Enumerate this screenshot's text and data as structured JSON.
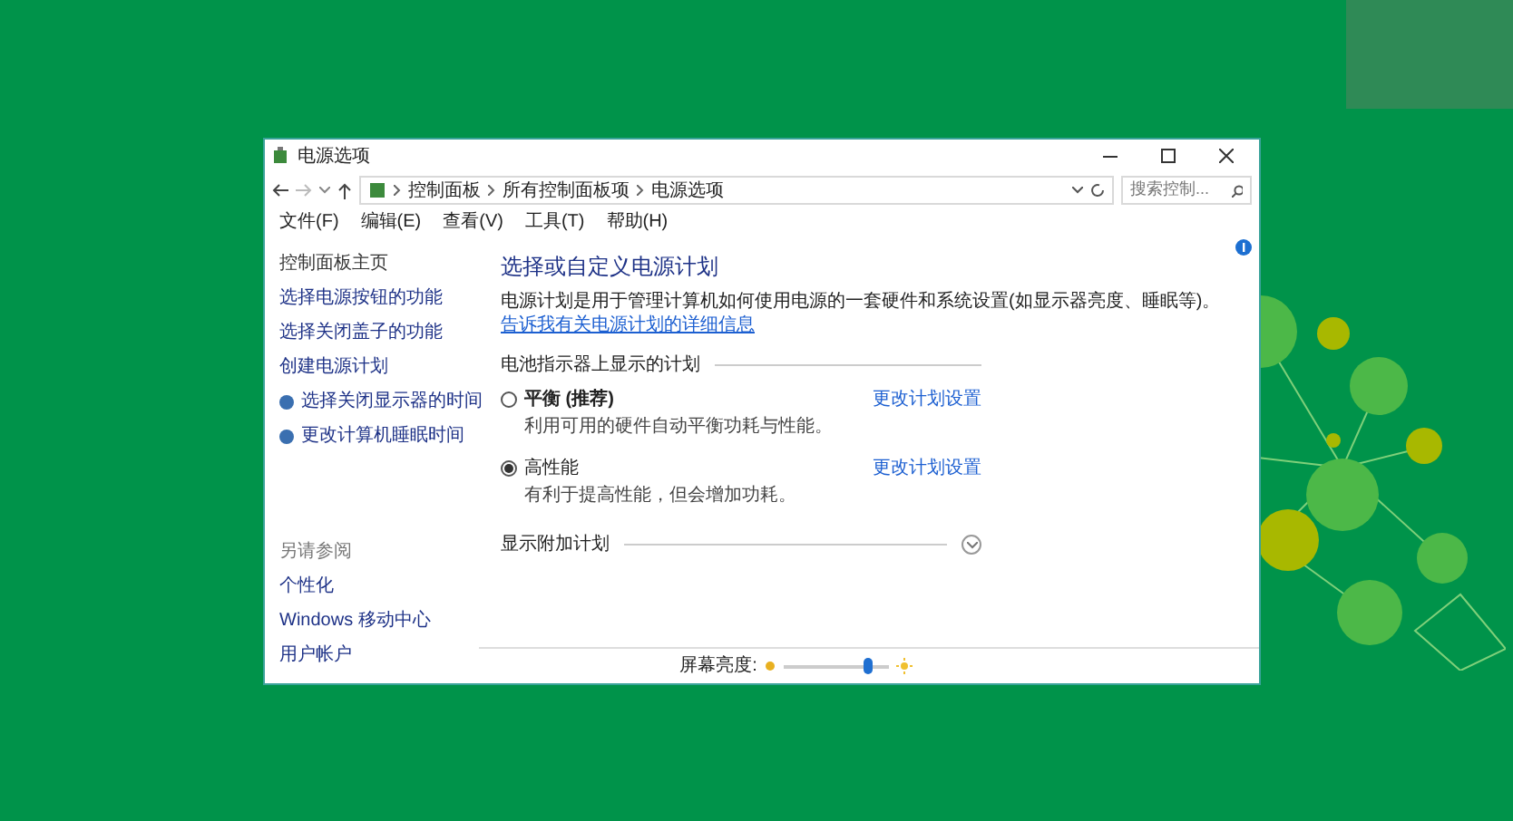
{
  "window": {
    "title": "电源选项"
  },
  "address_bar": {
    "breadcrumbs": [
      "控制面板",
      "所有控制面板项",
      "电源选项"
    ]
  },
  "search": {
    "placeholder": "搜索控制..."
  },
  "menu": [
    "文件(F)",
    "编辑(E)",
    "查看(V)",
    "工具(T)",
    "帮助(H)"
  ],
  "sidebar": {
    "items": [
      {
        "label": "控制面板主页",
        "kind": "plain"
      },
      {
        "label": "选择电源按钮的功能",
        "kind": "link"
      },
      {
        "label": "选择关闭盖子的功能",
        "kind": "link"
      },
      {
        "label": "创建电源计划",
        "kind": "link"
      },
      {
        "label": "选择关闭显示器的时间",
        "kind": "icon"
      },
      {
        "label": "更改计算机睡眠时间",
        "kind": "icon"
      }
    ],
    "see_also": {
      "heading": "另请参阅",
      "items": [
        "个性化",
        "Windows 移动中心",
        "用户帐户"
      ]
    }
  },
  "main": {
    "heading": "选择或自定义电源计划",
    "description": "电源计划是用于管理计算机如何使用电源的一套硬件和系统设置(如显示器亮度、睡眠等)。",
    "description_link": "告诉我有关电源计划的详细信息",
    "group_label": "电池指示器上显示的计划",
    "plans": [
      {
        "name": "平衡 (推荐)",
        "description": "利用可用的硬件自动平衡功耗与性能。",
        "selected": false,
        "link": "更改计划设置"
      },
      {
        "name": "高性能",
        "description": "有利于提高性能，但会增加功耗。",
        "selected": true,
        "link": "更改计划设置"
      }
    ],
    "more_plans": {
      "label": "显示附加计划",
      "expanded": false
    }
  },
  "brightness": {
    "label": "屏幕亮度:",
    "level": 0.8
  }
}
